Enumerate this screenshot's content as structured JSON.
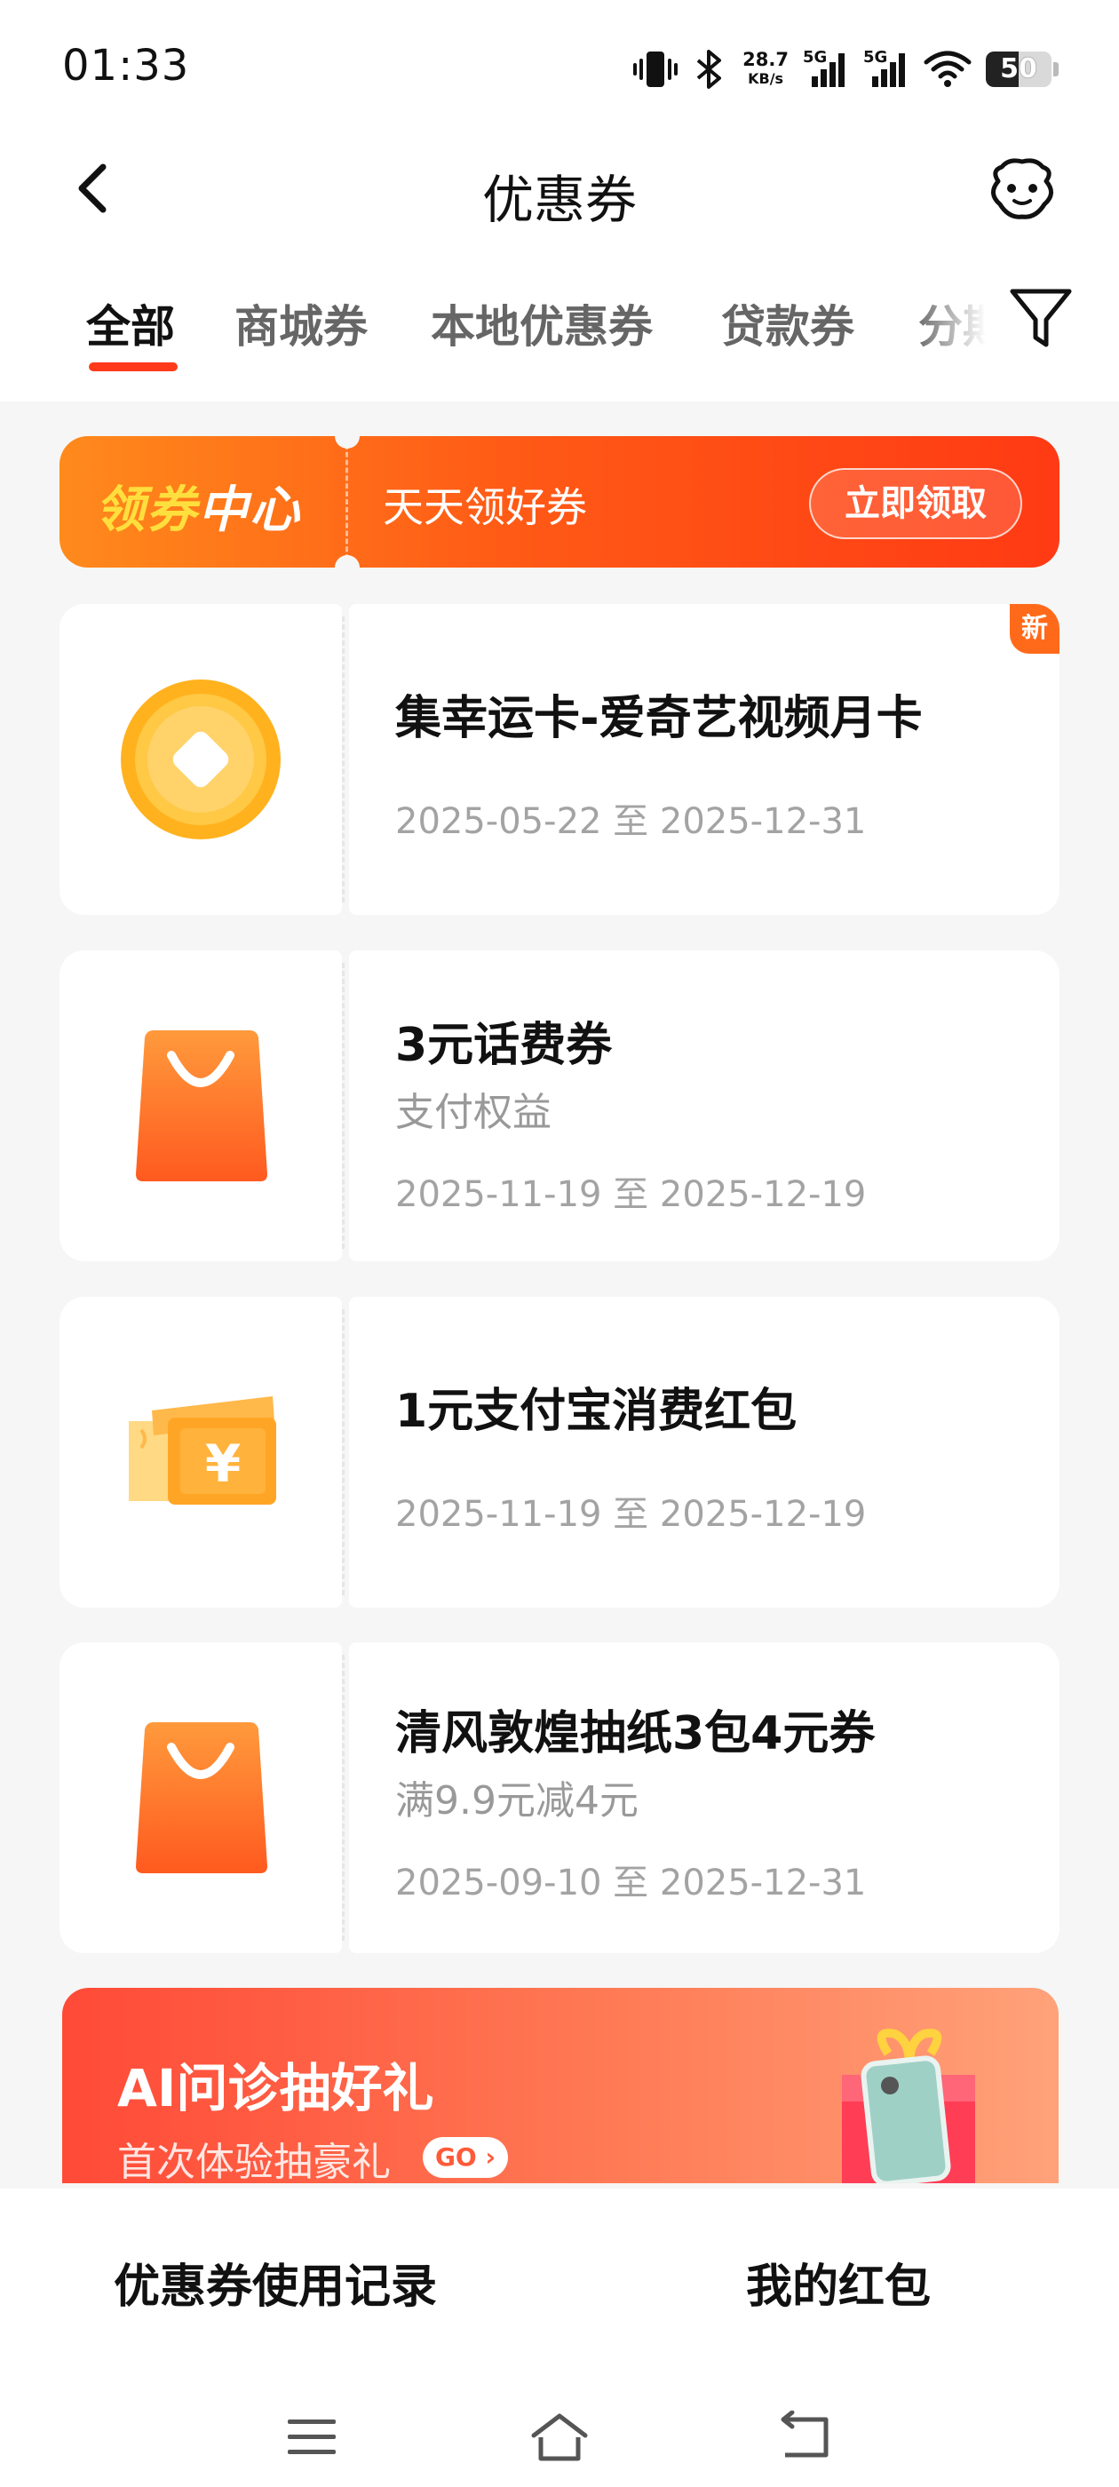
{
  "status_bar": {
    "time": "01:33",
    "net_speed_value": "28.7",
    "net_speed_unit": "KB/s",
    "sim1_label": "5G",
    "sim2_label": "5G",
    "battery": "50",
    "battery_level": 0.5
  },
  "header": {
    "title": "优惠券",
    "icons": {
      "back": "back-icon",
      "service": "customer-service-icon",
      "filter": "filter-icon"
    }
  },
  "tabs": [
    {
      "label": "全部",
      "active": true
    },
    {
      "label": "商城券",
      "active": false
    },
    {
      "label": "本地优惠券",
      "active": false
    },
    {
      "label": "贷款券",
      "active": false
    },
    {
      "label": "分期",
      "active": false
    }
  ],
  "banner": {
    "logo_part1": "领券",
    "logo_part2": "中心",
    "slogan": "天天领好券",
    "button": "立即领取"
  },
  "coupons": [
    {
      "name": "集幸运卡-爱奇艺视频月卡",
      "subtitle": "",
      "date": "2025-05-22 至 2025-12-31",
      "badge": "新",
      "icon": "gold-coin-icon"
    },
    {
      "name": "3元话费券",
      "subtitle": "支付权益",
      "date": "2025-11-19 至 2025-12-19",
      "badge": "",
      "icon": "shopping-bag-icon"
    },
    {
      "name": "1元支付宝消费红包",
      "subtitle": "",
      "date": "2025-11-19 至 2025-12-19",
      "badge": "",
      "icon": "yuan-ticket-icon"
    },
    {
      "name": "清风敦煌抽纸3包4元券",
      "subtitle": "满9.9元减4元",
      "date": "2025-09-10 至 2025-12-31",
      "badge": "",
      "icon": "shopping-bag-icon"
    }
  ],
  "promo": {
    "title": "AI问诊抽好礼",
    "subtitle": "首次体验抽豪礼",
    "go": "GO",
    "icon": "gift-phone-icon"
  },
  "bottom": {
    "history": "优惠券使用记录",
    "red_packet": "我的红包"
  },
  "system_nav": {
    "menu": "menu-icon",
    "home": "home-icon",
    "back": "back-gesture-icon"
  },
  "colors": {
    "accent": "#ff3a1a",
    "banner_start": "#ff8a1c",
    "banner_end": "#ff3a14",
    "promo_start": "#ff4a37"
  }
}
